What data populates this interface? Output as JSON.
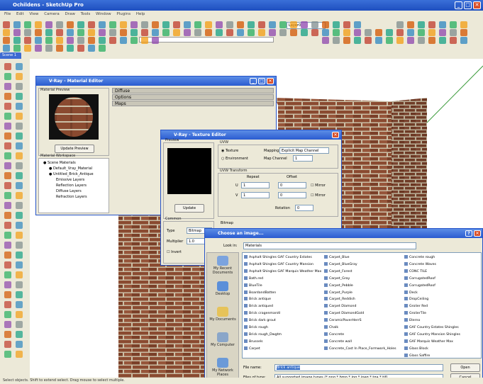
{
  "app": {
    "title": "Ochildens - SketchUp Pro",
    "menu": [
      "File",
      "Edit",
      "View",
      "Camera",
      "Draw",
      "Tools",
      "Window",
      "Plugins",
      "Help"
    ],
    "layer": "Layer0",
    "scene_tab": "Scene 1",
    "status": "Select objects. Shift to extend select. Drag mouse to select multiple."
  },
  "material_editor": {
    "title": "V-Ray - Material Editor",
    "preview_label": "Material Preview",
    "update_preview": "Update Preview",
    "workspace_label": "Material Workspace",
    "sections": [
      "Diffuse",
      "Options",
      "Maps"
    ],
    "tree": [
      "Scene Materials",
      "Default_Vray_Material",
      "Untitled_Brick_Antique",
      "Emissive Layers",
      "Reflection Layers",
      "Diffuse Layers",
      "Refraction Layers"
    ]
  },
  "texture_editor": {
    "title": "V-Ray - Texture Editor",
    "preview_label": "Preview",
    "update": "Update",
    "uvw_label": "UVW",
    "texture_radio": "Texture",
    "environment_radio": "Environment",
    "mapping_label": "Mapping",
    "mapping_value": "Explicit Map Channel",
    "map_channel_label": "Map Channel",
    "map_channel_value": "1",
    "uvw_transform_label": "UVW Transform",
    "repeat_label": "Repeat",
    "offset_label": "Offset",
    "u_label": "U",
    "v_label": "V",
    "mirror_label": "Mirror",
    "rotation_label": "Rotation",
    "rotation_value": "0",
    "u_repeat": "1",
    "v_repeat": "1",
    "u_offset": "0",
    "v_offset": "0",
    "common_label": "Common",
    "type_label": "Type",
    "type_value": "Bitmap",
    "multiplier_label": "Multiplier",
    "multiplier_value": "1.0",
    "invert_label": "Invert",
    "bitmap_label": "Bitmap"
  },
  "file_dialog": {
    "title": "Choose an image...",
    "look_in_label": "Look in:",
    "look_in_value": "Materials",
    "places": [
      "My Recent Documents",
      "Desktop",
      "My Documents",
      "My Computer",
      "My Network Places"
    ],
    "columns": [
      [
        "Asphalt Shingles GAF Country Estates",
        "Asphalt Shingles GAF Country Mansion",
        "Asphalt Shingles GAF Marquis Weather Max",
        "Bath.red",
        "BlueTile",
        "BoardandBatten",
        "Brick antique",
        "Brick antiqued",
        "Brick cragenmarstl",
        "Brick dark grout",
        "Brick rough",
        "Brick rough_Dwgtm",
        "Brussels",
        "Carpet"
      ],
      [
        "Carpet_Blue",
        "Carpet_BlueGray",
        "Carpet_Forest",
        "Carpet_Gray",
        "Carpet_Pebble",
        "Carpet_Purple",
        "Carpet_Reddish",
        "Carpet Diamond",
        "Carpet DiamondGold",
        "CeramicPaverHerrS",
        "Chalk",
        "Concrete",
        "Concrete wall",
        "Concrete_Cast In Place_Formwork_Holes"
      ],
      [
        "Concrete rough",
        "Concrete Waves",
        "CONC TILE",
        "CorrugatedRoof",
        "CorrugatedRoof",
        "Deck",
        "DropCeiling",
        "Grolier Red",
        "GrolierTile",
        "Eterno",
        "GAF Country Estates Shingles",
        "GAF Country Mansion Shingles",
        "GAF Marquis Weather Max",
        "Glass Block",
        "Glass Saffire"
      ]
    ],
    "file_name_label": "File name:",
    "file_name_value": "Brick antique",
    "files_of_type_label": "Files of type:",
    "files_of_type_value": "All supported image types (*.png *.bmp *.jpg *.jpeg *.tga *.tif)",
    "open": "Open",
    "cancel": "Cancel"
  },
  "colors": {
    "title_blue": "#2a5bd0",
    "window_face": "#ece9d8",
    "brick": "#8a4a30",
    "mortar": "#cbbfa6"
  }
}
